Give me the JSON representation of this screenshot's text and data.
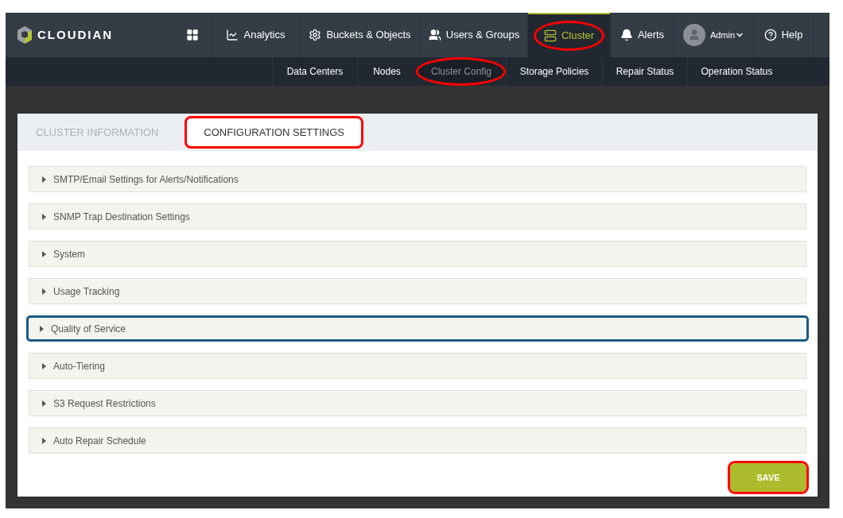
{
  "brand": "CLOUDIAN",
  "nav": [
    {
      "kind": "grid",
      "selected": false,
      "highlighted": false
    },
    {
      "kind": "chart",
      "label": "Analytics",
      "selected": false,
      "highlighted": false
    },
    {
      "kind": "gear",
      "label": "Buckets & Objects",
      "selected": false,
      "highlighted": false
    },
    {
      "kind": "users",
      "label": "Users & Groups",
      "selected": false,
      "highlighted": false
    },
    {
      "kind": "server",
      "label": "Cluster",
      "selected": true,
      "highlighted": true
    },
    {
      "kind": "bell",
      "label": "Alerts",
      "selected": false,
      "highlighted": false
    },
    {
      "kind": "user",
      "label": "Admin",
      "selected": false,
      "highlighted": false
    },
    {
      "kind": "help",
      "label": "Help",
      "selected": false,
      "highlighted": false
    }
  ],
  "subnav": [
    {
      "label": "Data Centers",
      "selected": false,
      "highlighted": false
    },
    {
      "label": "Nodes",
      "selected": false,
      "highlighted": false
    },
    {
      "label": "Cluster Config",
      "selected": true,
      "highlighted": true
    },
    {
      "label": "Storage Policies",
      "selected": false,
      "highlighted": false
    },
    {
      "label": "Repair Status",
      "selected": false,
      "highlighted": false
    },
    {
      "label": "Operation Status",
      "selected": false,
      "highlighted": false
    }
  ],
  "tabs": [
    {
      "label": "CLUSTER INFORMATION",
      "selected": false,
      "highlighted": false
    },
    {
      "label": "CONFIGURATION SETTINGS",
      "selected": true,
      "highlighted": true
    }
  ],
  "sections": [
    {
      "label": "SMTP/Email Settings for Alerts/Notifications",
      "expanded": false,
      "highlighted": false
    },
    {
      "label": "SNMP Trap Destination Settings",
      "expanded": false,
      "highlighted": false
    },
    {
      "label": "System",
      "expanded": false,
      "highlighted": false
    },
    {
      "label": "Usage Tracking",
      "expanded": false,
      "highlighted": false
    },
    {
      "label": "Quality of Service",
      "expanded": false,
      "highlighted": true
    },
    {
      "label": "Auto-Tiering",
      "expanded": false,
      "highlighted": false
    },
    {
      "label": "S3 Request Restrictions",
      "expanded": false,
      "highlighted": false
    },
    {
      "label": "Auto Repair Schedule",
      "expanded": false,
      "highlighted": false
    }
  ],
  "save": {
    "label": "SAVE",
    "highlighted": true
  }
}
